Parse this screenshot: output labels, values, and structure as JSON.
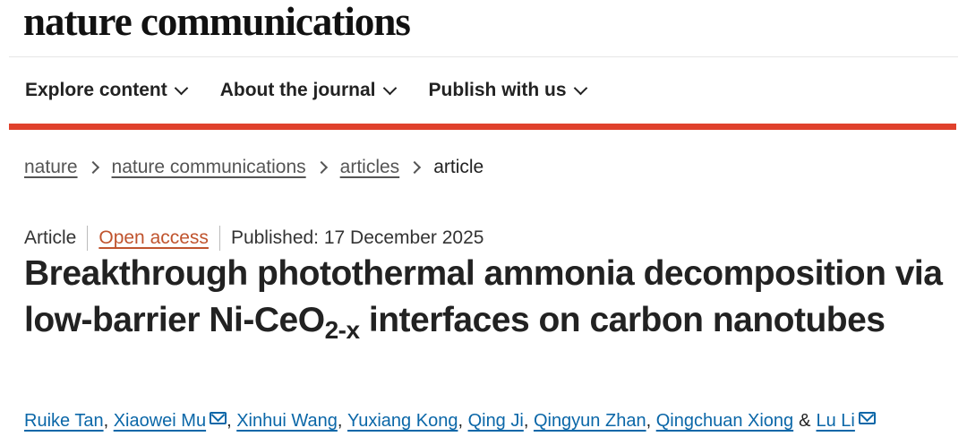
{
  "site": {
    "brand": "nature communications"
  },
  "nav": [
    {
      "label": "Explore content"
    },
    {
      "label": "About the journal"
    },
    {
      "label": "Publish with us"
    }
  ],
  "breadcrumb": [
    "nature",
    "nature communications",
    "articles",
    "article"
  ],
  "meta": {
    "type": "Article",
    "access": "Open access",
    "published": "Published: 17 December 2025"
  },
  "title": {
    "part1": "Breakthrough photothermal ammonia decomposition via low-barrier Ni-CeO",
    "sub": "2-x",
    "part2": " interfaces on carbon nanotubes"
  },
  "authors": [
    {
      "name": "Ruike Tan"
    },
    {
      "name": "Xiaowei Mu"
    },
    {
      "name": "Xinhui Wang"
    },
    {
      "name": "Yuxiang Kong"
    },
    {
      "name": "Qing Ji"
    },
    {
      "name": "Qingyun Zhan"
    },
    {
      "name": "Qingchuan Xiong"
    },
    {
      "name": "Lu Li"
    }
  ],
  "authors_conjunction": "&",
  "colors": {
    "accent_bar": "#e0412c",
    "open_access": "#c0542e",
    "link": "#0b67a8"
  }
}
